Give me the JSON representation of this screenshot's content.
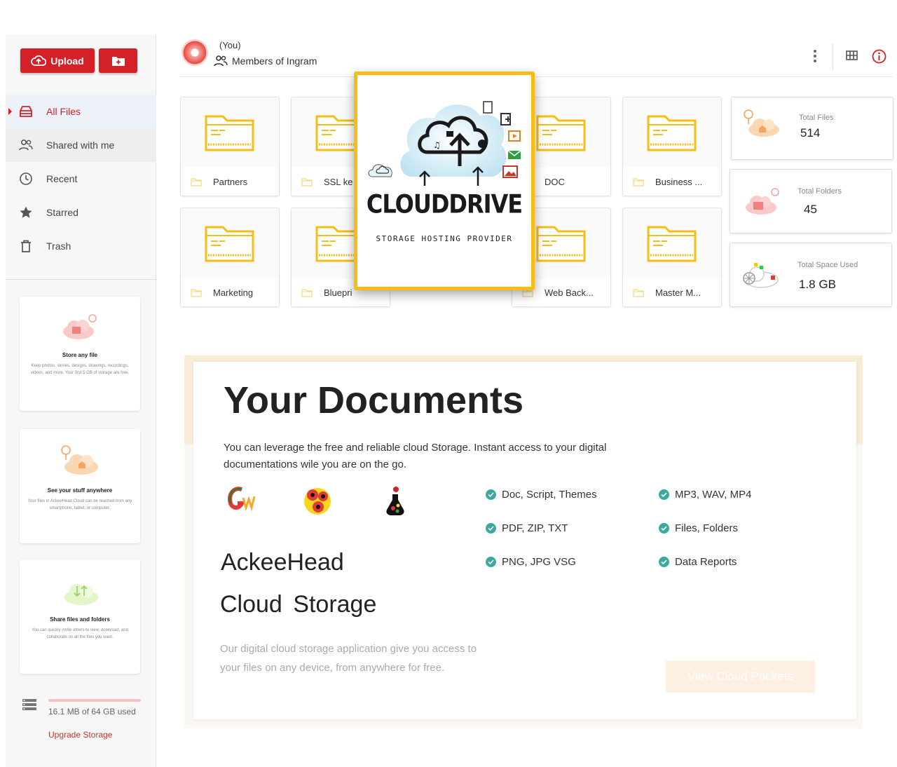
{
  "sidebar": {
    "upload_label": "Upload",
    "nav": [
      {
        "label": "All Files"
      },
      {
        "label": "Shared with me"
      },
      {
        "label": "Recent"
      },
      {
        "label": "Starred"
      },
      {
        "label": "Trash"
      }
    ],
    "promos": [
      {
        "title": "Store any file",
        "desc": "Keep photos, stories, designs, drawings, recordings, videos, and more. Your first 5 GB of storage are free."
      },
      {
        "title": "See your stuff anywhere",
        "desc": "Your files in AckeeHead Cloud can be reached from any smartphone, tablet, or computer."
      },
      {
        "title": "Share files and folders",
        "desc": "You can quickly invite others to view, download, and collaborate on all the files you want."
      }
    ],
    "storage_text": "16.1 MB of 64 GB used",
    "upgrade_label": "Upgrade Storage"
  },
  "header": {
    "owner": "(You)",
    "members": "Members of Ingram"
  },
  "folders": [
    {
      "name": "Partners"
    },
    {
      "name": "SSL ke"
    },
    {
      "name": "DOC"
    },
    {
      "name": "Business ..."
    },
    {
      "name": "Marketing"
    },
    {
      "name": "Bluepri"
    },
    {
      "name": "Web Back..."
    },
    {
      "name": "Master M..."
    }
  ],
  "stats": {
    "total_files_label": "Total Files",
    "total_files": "514",
    "total_folders_label": "Total Folders",
    "total_folders": "45",
    "space_label": "Total Space Used",
    "space": "1.8 GB"
  },
  "overlay": {
    "title": "CLOUDDRIVE",
    "subtitle": "STORAGE HOSTING PROVIDER"
  },
  "documents": {
    "heading": "Your Documents",
    "intro": "You can leverage the free and reliable cloud Storage. Instant access to your digital documentations wile you are on the go.",
    "brand_line1": "AckeeHead",
    "brand_line2": "Cloud Storage",
    "description": "Our digital cloud storage application give you access to your files on any device, from anywhere for free.",
    "button_label": "View Cloud Pockets",
    "features_left": [
      "Doc, Script, Themes",
      "PDF, ZIP, TXT",
      "PNG, JPG VSG"
    ],
    "features_right": [
      "MP3, WAV, MP4",
      "Files, Folders",
      "Data Reports"
    ]
  },
  "colors": {
    "accent": "#d42027",
    "folder": "#f6bd16",
    "check": "#3aa99f"
  }
}
